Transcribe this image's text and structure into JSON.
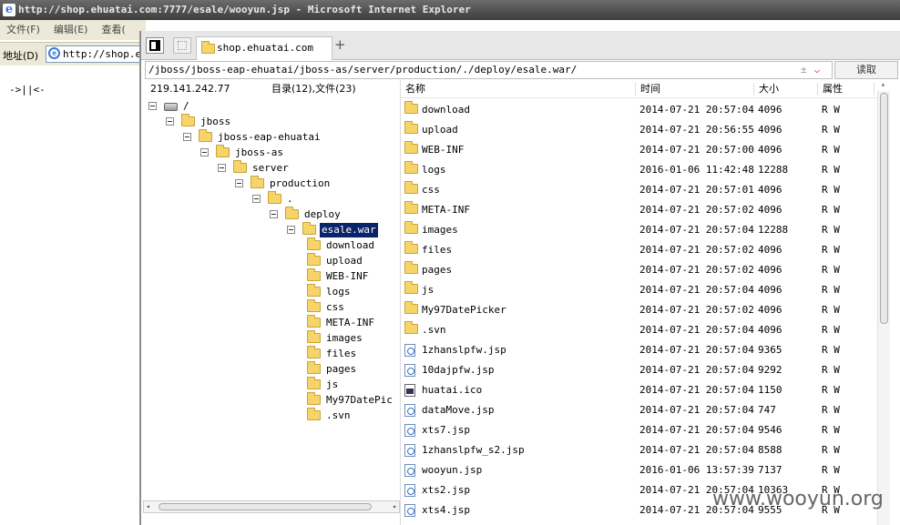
{
  "browser": {
    "title": "http://shop.ehuatai.com:7777/esale/wooyun.jsp - Microsoft Internet Explorer",
    "menu": [
      "文件(F)",
      "编辑(E)",
      "查看("
    ],
    "address_label": "地址(D)",
    "address_value": "http://shop.eh",
    "page_text": "->||<-"
  },
  "manager": {
    "tab_label": "shop.ehuatai.com",
    "add_tab": "+",
    "path": "/jboss/jboss-eap-ehuatai/jboss-as/server/production/./deploy/esale.war/",
    "path_icons": {
      "expand": "±",
      "dropdown": "⌵"
    },
    "read_button": "读取",
    "left": {
      "ip": "219.141.242.77",
      "count": "目录(12),文件(23)"
    },
    "tree": [
      {
        "label": "/",
        "depth": 0,
        "icon": "drive"
      },
      {
        "label": "jboss",
        "depth": 1
      },
      {
        "label": "jboss-eap-ehuatai",
        "depth": 2
      },
      {
        "label": "jboss-as",
        "depth": 3
      },
      {
        "label": "server",
        "depth": 4
      },
      {
        "label": "production",
        "depth": 5
      },
      {
        "label": ".",
        "depth": 6
      },
      {
        "label": "deploy",
        "depth": 7
      },
      {
        "label": "esale.war",
        "depth": 8,
        "selected": true
      },
      {
        "label": "download",
        "depth": 9,
        "leaf": true
      },
      {
        "label": "upload",
        "depth": 9,
        "leaf": true
      },
      {
        "label": "WEB-INF",
        "depth": 9,
        "leaf": true
      },
      {
        "label": "logs",
        "depth": 9,
        "leaf": true
      },
      {
        "label": "css",
        "depth": 9,
        "leaf": true
      },
      {
        "label": "META-INF",
        "depth": 9,
        "leaf": true
      },
      {
        "label": "images",
        "depth": 9,
        "leaf": true
      },
      {
        "label": "files",
        "depth": 9,
        "leaf": true
      },
      {
        "label": "pages",
        "depth": 9,
        "leaf": true
      },
      {
        "label": "js",
        "depth": 9,
        "leaf": true
      },
      {
        "label": "My97DatePic",
        "depth": 9,
        "leaf": true
      },
      {
        "label": ".svn",
        "depth": 9,
        "leaf": true
      }
    ],
    "columns": {
      "name": "名称",
      "time": "时间",
      "size": "大小",
      "attr": "属性"
    },
    "files": [
      {
        "name": "download",
        "time": "2014-07-21 20:57:04",
        "size": "4096",
        "attr": "R W",
        "type": "folder"
      },
      {
        "name": "upload",
        "time": "2014-07-21 20:56:55",
        "size": "4096",
        "attr": "R W",
        "type": "folder"
      },
      {
        "name": "WEB-INF",
        "time": "2014-07-21 20:57:00",
        "size": "4096",
        "attr": "R W",
        "type": "folder"
      },
      {
        "name": "logs",
        "time": "2016-01-06 11:42:48",
        "size": "12288",
        "attr": "R W",
        "type": "folder"
      },
      {
        "name": "css",
        "time": "2014-07-21 20:57:01",
        "size": "4096",
        "attr": "R W",
        "type": "folder"
      },
      {
        "name": "META-INF",
        "time": "2014-07-21 20:57:02",
        "size": "4096",
        "attr": "R W",
        "type": "folder"
      },
      {
        "name": "images",
        "time": "2014-07-21 20:57:04",
        "size": "12288",
        "attr": "R W",
        "type": "folder"
      },
      {
        "name": "files",
        "time": "2014-07-21 20:57:02",
        "size": "4096",
        "attr": "R W",
        "type": "folder"
      },
      {
        "name": "pages",
        "time": "2014-07-21 20:57:02",
        "size": "4096",
        "attr": "R W",
        "type": "folder"
      },
      {
        "name": "js",
        "time": "2014-07-21 20:57:04",
        "size": "4096",
        "attr": "R W",
        "type": "folder"
      },
      {
        "name": "My97DatePicker",
        "time": "2014-07-21 20:57:02",
        "size": "4096",
        "attr": "R W",
        "type": "folder"
      },
      {
        "name": ".svn",
        "time": "2014-07-21 20:57:04",
        "size": "4096",
        "attr": "R W",
        "type": "folder"
      },
      {
        "name": "1zhanslpfw.jsp",
        "time": "2014-07-21 20:57:04",
        "size": "9365",
        "attr": "R W",
        "type": "file"
      },
      {
        "name": "10dajpfw.jsp",
        "time": "2014-07-21 20:57:04",
        "size": "9292",
        "attr": "R W",
        "type": "file"
      },
      {
        "name": "huatai.ico",
        "time": "2014-07-21 20:57:04",
        "size": "1150",
        "attr": "R W",
        "type": "ico"
      },
      {
        "name": "dataMove.jsp",
        "time": "2014-07-21 20:57:04",
        "size": "747",
        "attr": "R W",
        "type": "file"
      },
      {
        "name": "xts7.jsp",
        "time": "2014-07-21 20:57:04",
        "size": "9546",
        "attr": "R W",
        "type": "file"
      },
      {
        "name": "1zhanslpfw_s2.jsp",
        "time": "2014-07-21 20:57:04",
        "size": "8588",
        "attr": "R W",
        "type": "file"
      },
      {
        "name": "wooyun.jsp",
        "time": "2016-01-06 13:57:39",
        "size": "7137",
        "attr": "R W",
        "type": "file"
      },
      {
        "name": "xts2.jsp",
        "time": "2014-07-21 20:57:04",
        "size": "10363",
        "attr": "R W",
        "type": "file"
      },
      {
        "name": "xts4.jsp",
        "time": "2014-07-21 20:57:04",
        "size": "9555",
        "attr": "R W",
        "type": "file"
      }
    ]
  },
  "watermark": "www.wooyun.org"
}
